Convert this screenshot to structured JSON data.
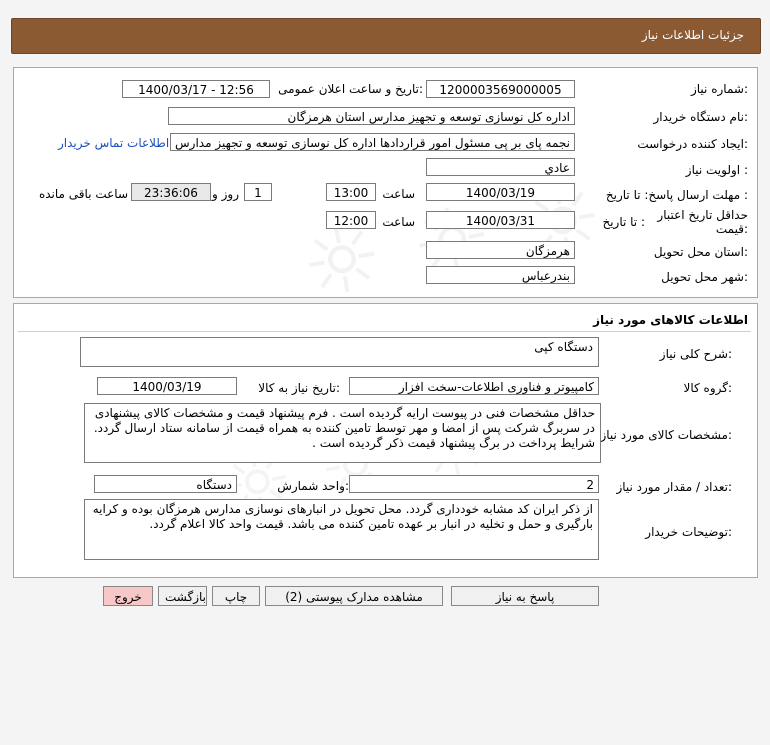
{
  "header": {
    "title": "جزئیات اطلاعات نیاز"
  },
  "need": {
    "need_number_label": "شماره نیاز:",
    "need_number": "1200003569000005",
    "announce_label": "تاریخ و ساعت اعلان عمومی:",
    "announce_value": "1400/03/17 - 12:56",
    "buyer_label": "نام دستگاه خریدار:",
    "buyer_value": "اداره کل نوسازی  توسعه و تجهیز مدارس استان هرمزگان",
    "creator_label": "ایجاد کننده درخواست:",
    "creator_value": "نجمه  پای بر پی مسئول امور قراردادها اداره کل نوسازی  توسعه و تجهیز مدارس",
    "contact_link": "اطلاعات تماس خریدار",
    "priority_label": "اولویت نیاز :",
    "priority_value": "عادي",
    "deadline_label": "مهلت ارسال پاسخ:  تا تاریخ :",
    "deadline_date": "1400/03/19",
    "time_label": "ساعت",
    "deadline_time": "13:00",
    "days_value": "1",
    "days_label": "روز و",
    "remaining_time": "23:36:06",
    "remaining_label": "ساعت باقی مانده",
    "validity_label_1": "حداقل تاریخ اعتبار",
    "validity_label_2": "قیمت:",
    "validity_to_label": "تا تاریخ :",
    "validity_date": "1400/03/31",
    "validity_time_label": "ساعت",
    "validity_time": "12:00",
    "province_label": "استان محل تحویل:",
    "province_value": "هرمزگان",
    "city_label": "شهر محل تحویل:",
    "city_value": "بندرعباس"
  },
  "goods": {
    "section_title": "اطلاعات کالاهای مورد نیاز",
    "summary_label": "شرح کلی نیاز:",
    "summary_value": "دستگاه کپی",
    "group_label": "گروه کالا:",
    "group_value": "کامپیوتر و فناوری اطلاعات-سخت افزار",
    "need_date_label": "تاریخ نیاز به کالا:",
    "need_date_value": "1400/03/19",
    "specs_label": "مشخصات کالای مورد نیاز:",
    "specs_value": "حداقل مشخصات فنی در پیوست ارایه گردیده است . فرم پیشنهاد قیمت و مشخصات کالای پیشنهادی در سربرگ شرکت پس از امضا و مهر توسط تامین کننده به همراه قیمت از سامانه ستاد ارسال گردد. شرایط پرداخت در برگ پیشنهاد قیمت ذکر گردیده است .",
    "qty_label": "تعداد / مقدار مورد نیاز:",
    "qty_value": "2",
    "unit_label": "واحد شمارش:",
    "unit_value": "دستگاه",
    "notes_label": "توضیحات خریدار:",
    "notes_value": "از ذکر ایران کد مشابه خودداری گردد. محل تحویل در انبارهای نوسازی مدارس هرمزگان بوده و کرایه بارگیری و حمل و تخلیه در انبار بر عهده تامین کننده می باشد. قیمت واحد کالا اعلام گردد."
  },
  "buttons": {
    "respond": "پاسخ به نیاز",
    "attachments": "مشاهده مدارک پیوستی (2)",
    "print": "چاپ",
    "back": "بازگشت",
    "exit": "خروج"
  },
  "colors": {
    "header_bg": "#8b5a33",
    "link": "#1a4fc0",
    "exit_bg": "#f7c7c7"
  }
}
